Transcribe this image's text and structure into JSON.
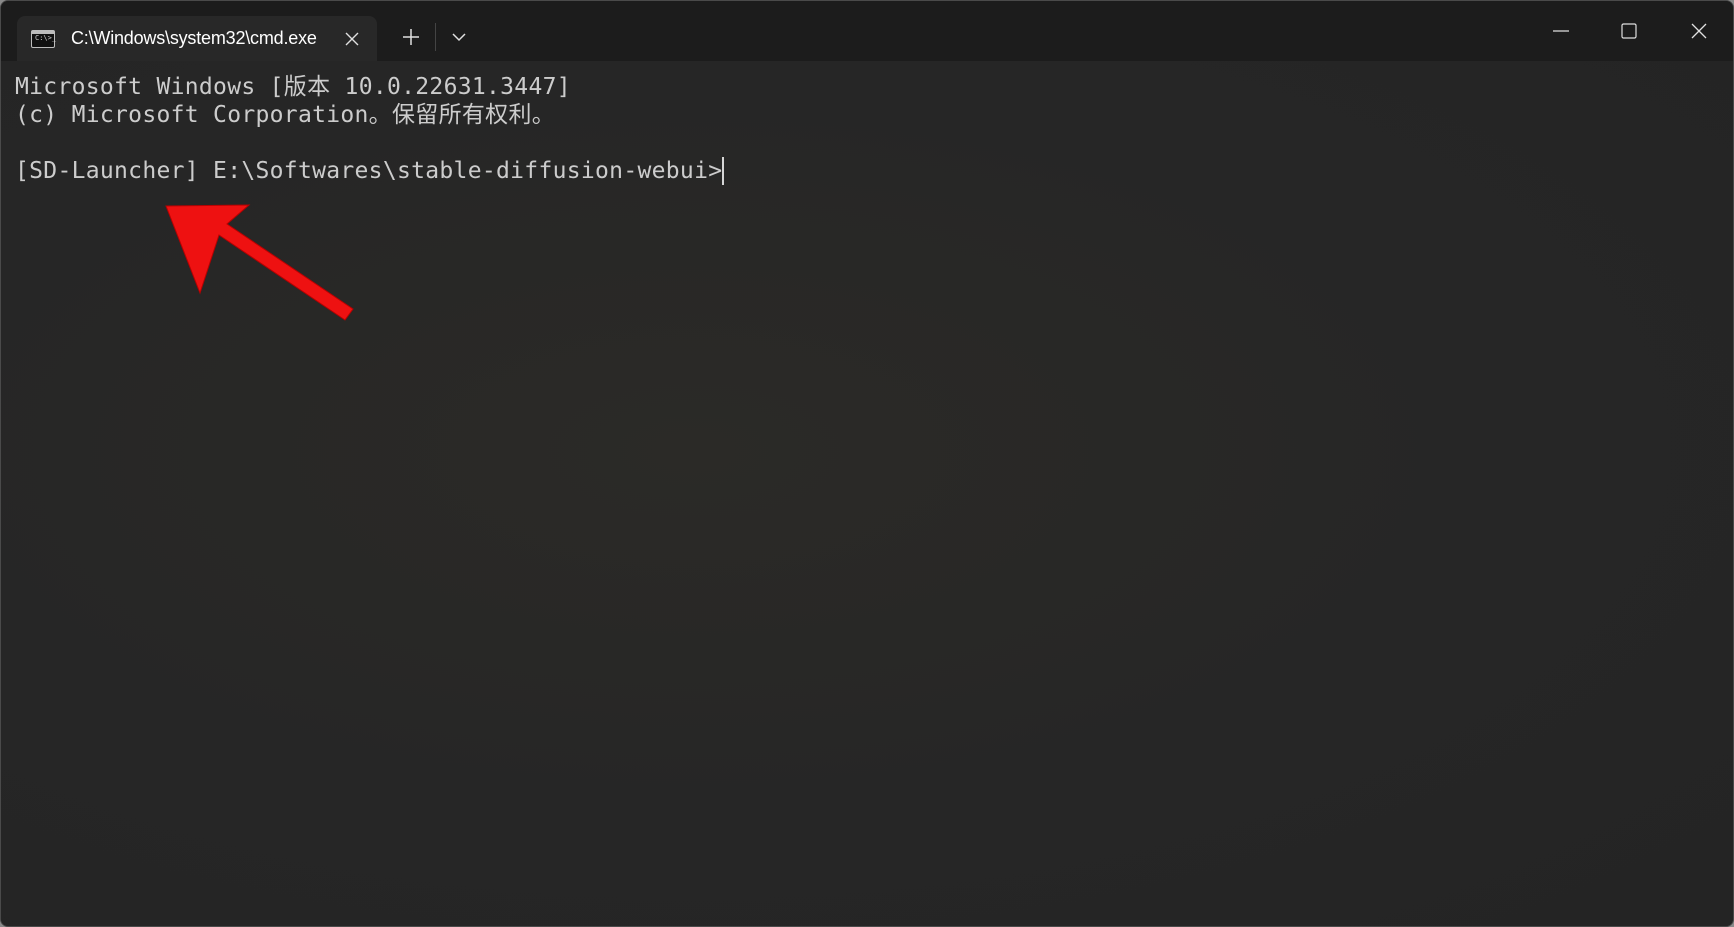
{
  "window": {
    "tab_title": "C:\\Windows\\system32\\cmd.exe",
    "tab_icon_glyph": "C:\\>_"
  },
  "terminal": {
    "line1": "Microsoft Windows [版本 10.0.22631.3447]",
    "line2": "(c) Microsoft Corporation。保留所有权利。",
    "prompt": "[SD-Launcher] E:\\Softwares\\stable-diffusion-webui>"
  },
  "colors": {
    "background": "#262626",
    "titlebar": "#1c1c1c",
    "text": "#cccccc",
    "annotation_arrow": "#ee1111"
  },
  "icons": {
    "tab": "cmd-icon",
    "tab_close": "close-icon",
    "new_tab": "plus-icon",
    "dropdown": "chevron-down-icon",
    "minimize": "minimize-icon",
    "maximize": "maximize-icon",
    "close": "close-icon"
  }
}
